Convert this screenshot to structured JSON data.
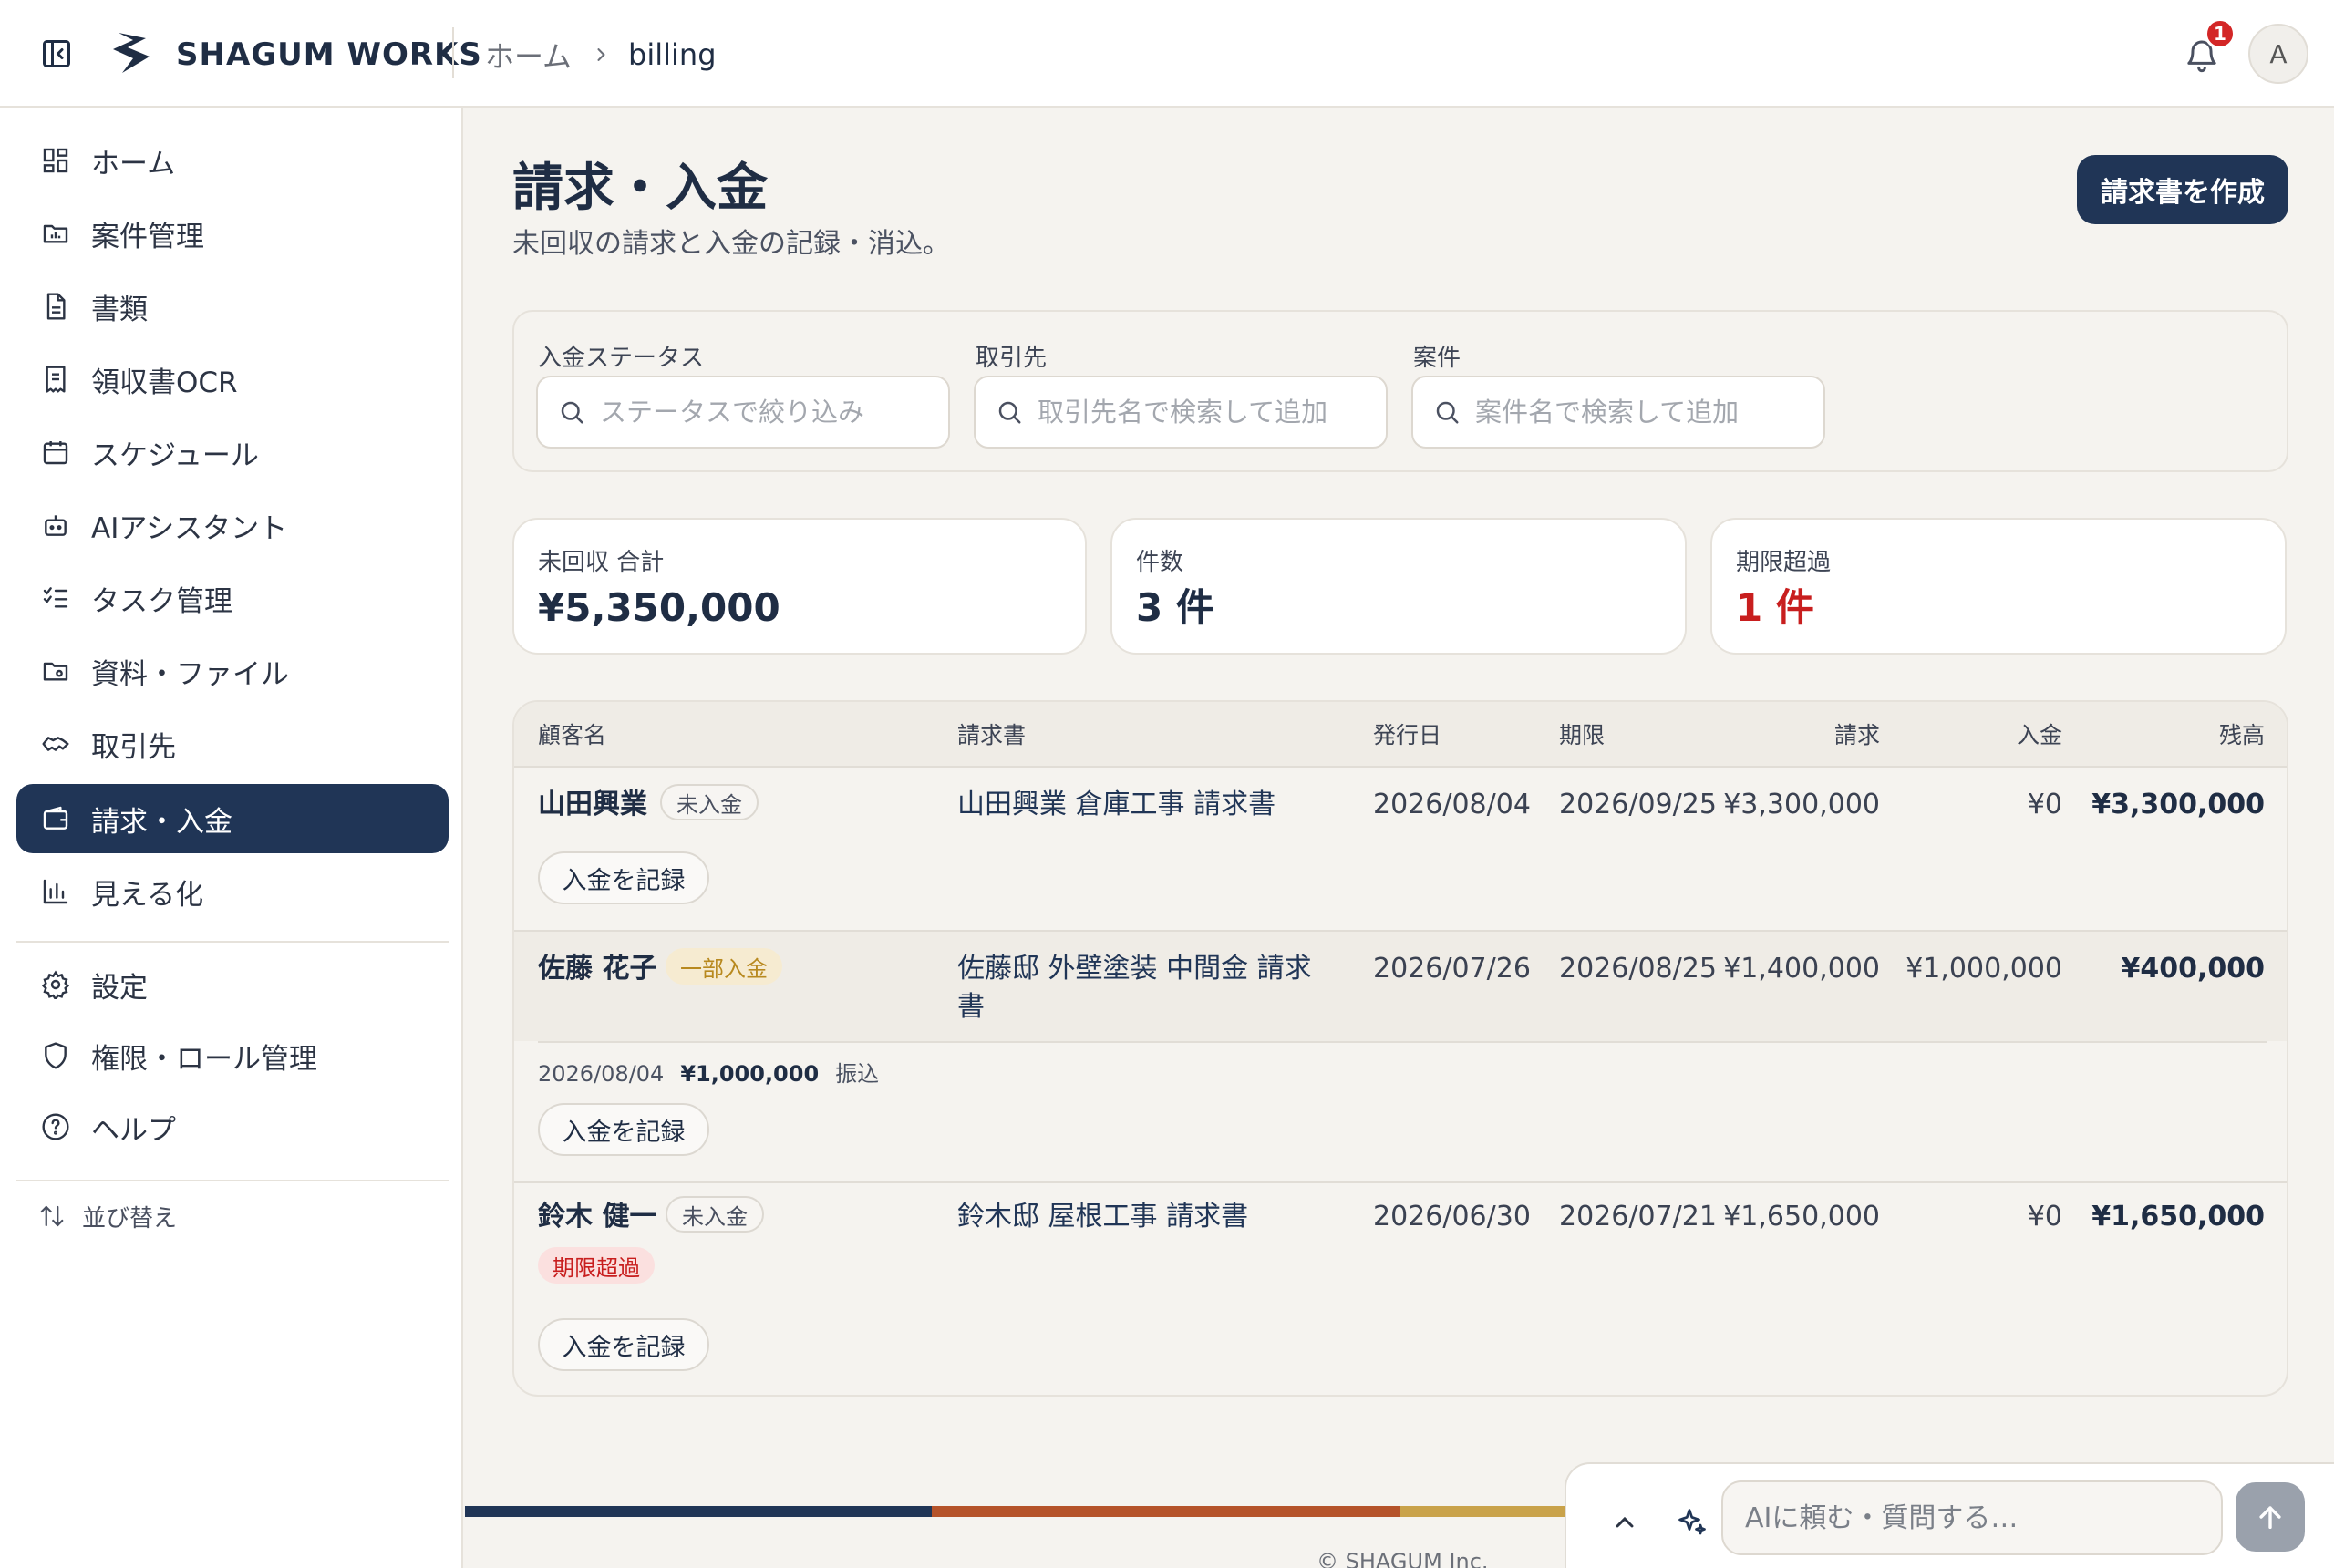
{
  "header": {
    "brand": "SHAGUM WORKS",
    "breadcrumb": {
      "home": "ホーム",
      "current": "billing"
    },
    "notification_count": "1",
    "avatar_initial": "A"
  },
  "sidebar": {
    "items": [
      {
        "label": "ホーム",
        "icon": "dashboard-grid-icon"
      },
      {
        "label": "案件管理",
        "icon": "folder-chart-icon"
      },
      {
        "label": "書類",
        "icon": "document-icon"
      },
      {
        "label": "領収書OCR",
        "icon": "receipt-icon"
      },
      {
        "label": "スケジュール",
        "icon": "calendar-icon"
      },
      {
        "label": "AIアシスタント",
        "icon": "robot-icon"
      },
      {
        "label": "タスク管理",
        "icon": "checklist-icon"
      },
      {
        "label": "資料・ファイル",
        "icon": "folder-file-icon"
      },
      {
        "label": "取引先",
        "icon": "handshake-icon"
      },
      {
        "label": "請求・入金",
        "icon": "wallet-icon",
        "active": true
      },
      {
        "label": "見える化",
        "icon": "bar-chart-icon"
      }
    ],
    "settings_items": [
      {
        "label": "設定",
        "icon": "gear-icon"
      },
      {
        "label": "権限・ロール管理",
        "icon": "shield-icon"
      },
      {
        "label": "ヘルプ",
        "icon": "help-circle-icon"
      }
    ],
    "sort_label": "並び替え"
  },
  "main": {
    "title": "請求・入金",
    "subtitle": "未回収の請求と入金の記録・消込。",
    "create_button": "請求書を作成",
    "filters": {
      "status": {
        "label": "入金ステータス",
        "placeholder": "ステータスで絞り込み"
      },
      "client": {
        "label": "取引先",
        "placeholder": "取引先名で検索して追加"
      },
      "project": {
        "label": "案件",
        "placeholder": "案件名で検索して追加"
      }
    },
    "stats": {
      "outstanding": {
        "label": "未回収 合計",
        "value": "¥5,350,000"
      },
      "count": {
        "label": "件数",
        "value": "3 件"
      },
      "overdue": {
        "label": "期限超過",
        "value": "1 件"
      }
    },
    "table": {
      "columns": [
        "顧客名",
        "請求書",
        "発行日",
        "期限",
        "請求",
        "入金",
        "残高"
      ],
      "record_button": "入金を記録",
      "rows": [
        {
          "customer": "山田興業",
          "status": "未入金",
          "invoice": "山田興業 倉庫工事 請求書",
          "issued": "2026/08/04",
          "due": "2026/09/25",
          "billed": "¥3,300,000",
          "paid": "¥0",
          "balance": "¥3,300,000"
        },
        {
          "customer": "佐藤 花子",
          "status": "一部入金",
          "invoice": "佐藤邸 外壁塗装 中間金 請求書",
          "issued": "2026/07/26",
          "due": "2026/08/25",
          "billed": "¥1,400,000",
          "paid": "¥1,000,000",
          "balance": "¥400,000",
          "payment": {
            "date": "2026/08/04",
            "amount": "¥1,000,000",
            "method": "振込"
          }
        },
        {
          "customer": "鈴木 健一",
          "status": "未入金",
          "overdue": "期限超過",
          "invoice": "鈴木邸 屋根工事 請求書",
          "issued": "2026/06/30",
          "due": "2026/07/21",
          "billed": "¥1,650,000",
          "paid": "¥0",
          "balance": "¥1,650,000"
        }
      ]
    }
  },
  "footer": {
    "copyright": "© SHAGUM Inc."
  },
  "ai_bar": {
    "placeholder": "AIに頼む・質問する…"
  },
  "colors": {
    "navy": "#203556",
    "rust": "#b5532a",
    "gold": "#c9a24a",
    "overdue_red": "#c81e1e",
    "partial_gold": "#b8891f"
  }
}
